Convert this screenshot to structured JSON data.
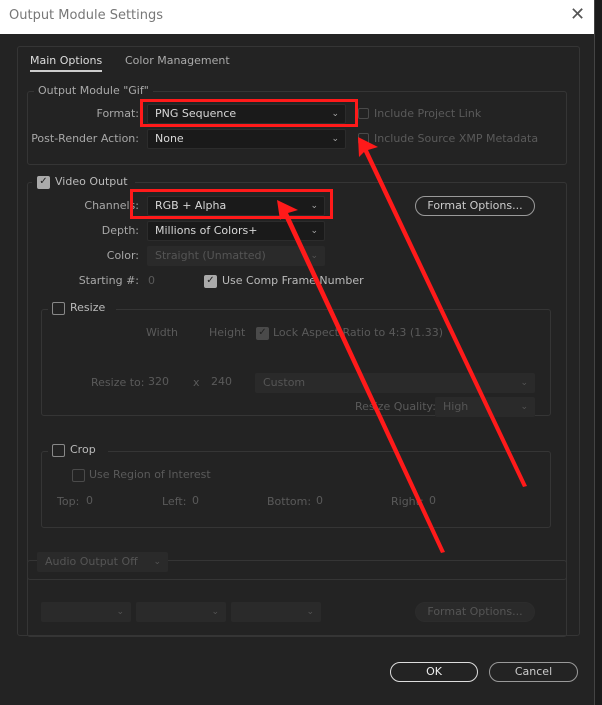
{
  "window": {
    "title": "Output Module Settings",
    "close_icon": "close-icon"
  },
  "tabs": [
    {
      "label": "Main Options",
      "active": true
    },
    {
      "label": "Color Management",
      "active": false
    }
  ],
  "output_module": {
    "legend": "Output Module \"Gif\"",
    "format_label": "Format:",
    "format_value": "PNG Sequence",
    "post_render_label": "Post-Render Action:",
    "post_render_value": "None",
    "include_project_link": "Include Project Link",
    "include_xmp": "Include Source XMP Metadata"
  },
  "video": {
    "label": "Video Output",
    "checked": true,
    "channels_label": "Channels:",
    "channels_value": "RGB + Alpha",
    "depth_label": "Depth:",
    "depth_value": "Millions of Colors+",
    "color_label": "Color:",
    "color_value": "Straight (Unmatted)",
    "starting_label": "Starting #:",
    "starting_value": "0",
    "use_comp_frame": "Use Comp Frame Number",
    "format_options": "Format Options..."
  },
  "resize": {
    "label": "Resize",
    "width_label": "Width",
    "height_label": "Height",
    "lock_label": "Lock Aspect Ratio to 4:3 (1.33)",
    "resize_to_label": "Resize to:",
    "width": "320",
    "x": "x",
    "height": "240",
    "preset": "Custom",
    "quality_label": "Resize Quality:",
    "quality": "High"
  },
  "crop": {
    "label": "Crop",
    "roi_label": "Use Region of Interest",
    "top_label": "Top:",
    "top": "0",
    "left_label": "Left:",
    "left": "0",
    "bottom_label": "Bottom:",
    "bottom": "0",
    "right_label": "Right:",
    "right": "0"
  },
  "audio": {
    "dropdown": "Audio Output Off",
    "format_options": "Format Options..."
  },
  "buttons": {
    "ok": "OK",
    "cancel": "Cancel"
  },
  "colors": {
    "annotation": "#ff1a1a",
    "background": "#232323"
  }
}
